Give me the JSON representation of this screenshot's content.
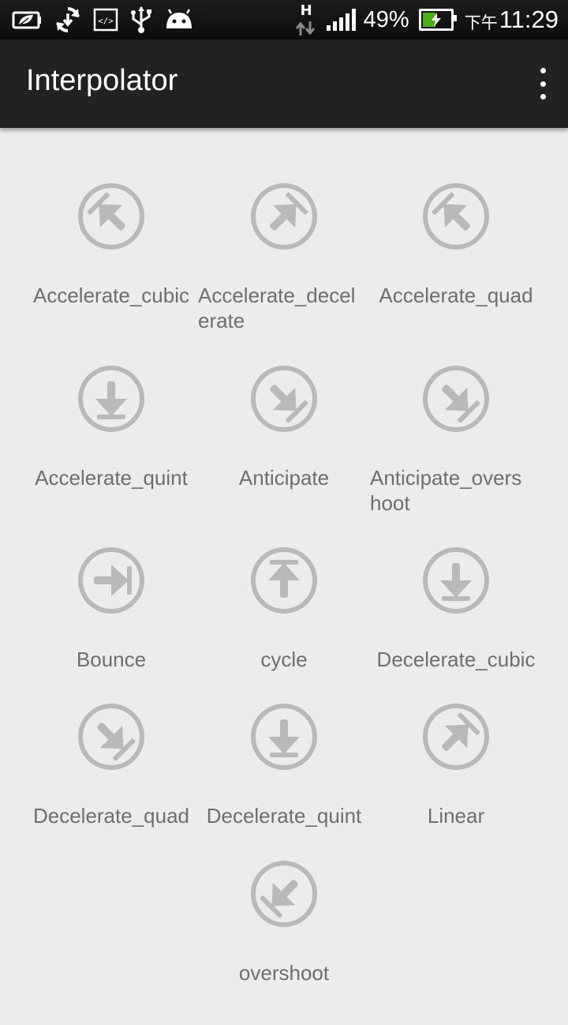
{
  "status_bar": {
    "network_type": "H",
    "battery_percent": "49%",
    "battery_level": 0.49,
    "clock_ampm": "下午",
    "clock_time": "11:29",
    "icons": [
      "battery-saver-icon",
      "sync-icon",
      "developer-icon",
      "usb-icon",
      "android-debug-icon",
      "hspa-data-icon",
      "signal-icon",
      "battery-icon"
    ]
  },
  "action_bar": {
    "title": "Interpolator",
    "overflow_icon": "overflow-menu-icon"
  },
  "colors": {
    "status_bar_bg": "#111111",
    "action_bar_bg": "#222222",
    "content_bg": "#ececec",
    "icon_gray": "#b9b9b9",
    "label_gray": "#6e6e6e",
    "battery_green": "#4caf1a"
  },
  "items": [
    {
      "label": "Accelerate_cubic",
      "icon": "arrow-up-left-icon"
    },
    {
      "label": "Accelerate_decel\nerate",
      "icon": "arrow-up-right-icon"
    },
    {
      "label": "Accelerate_quad",
      "icon": "arrow-up-left-icon"
    },
    {
      "label": "Accelerate_quint",
      "icon": "arrow-down-icon"
    },
    {
      "label": "Anticipate",
      "icon": "arrow-down-right-icon"
    },
    {
      "label": "Anticipate_overs\nhoot",
      "icon": "arrow-down-right-icon"
    },
    {
      "label": "Bounce",
      "icon": "arrow-right-icon"
    },
    {
      "label": "cycle",
      "icon": "arrow-up-icon"
    },
    {
      "label": "Decelerate_cubic",
      "icon": "arrow-down-icon"
    },
    {
      "label": "Decelerate_quad",
      "icon": "arrow-down-right-icon"
    },
    {
      "label": "Decelerate_quint",
      "icon": "arrow-down-icon"
    },
    {
      "label": "Linear",
      "icon": "arrow-up-right-icon"
    },
    {
      "label": "overshoot",
      "icon": "arrow-down-left-icon"
    }
  ]
}
